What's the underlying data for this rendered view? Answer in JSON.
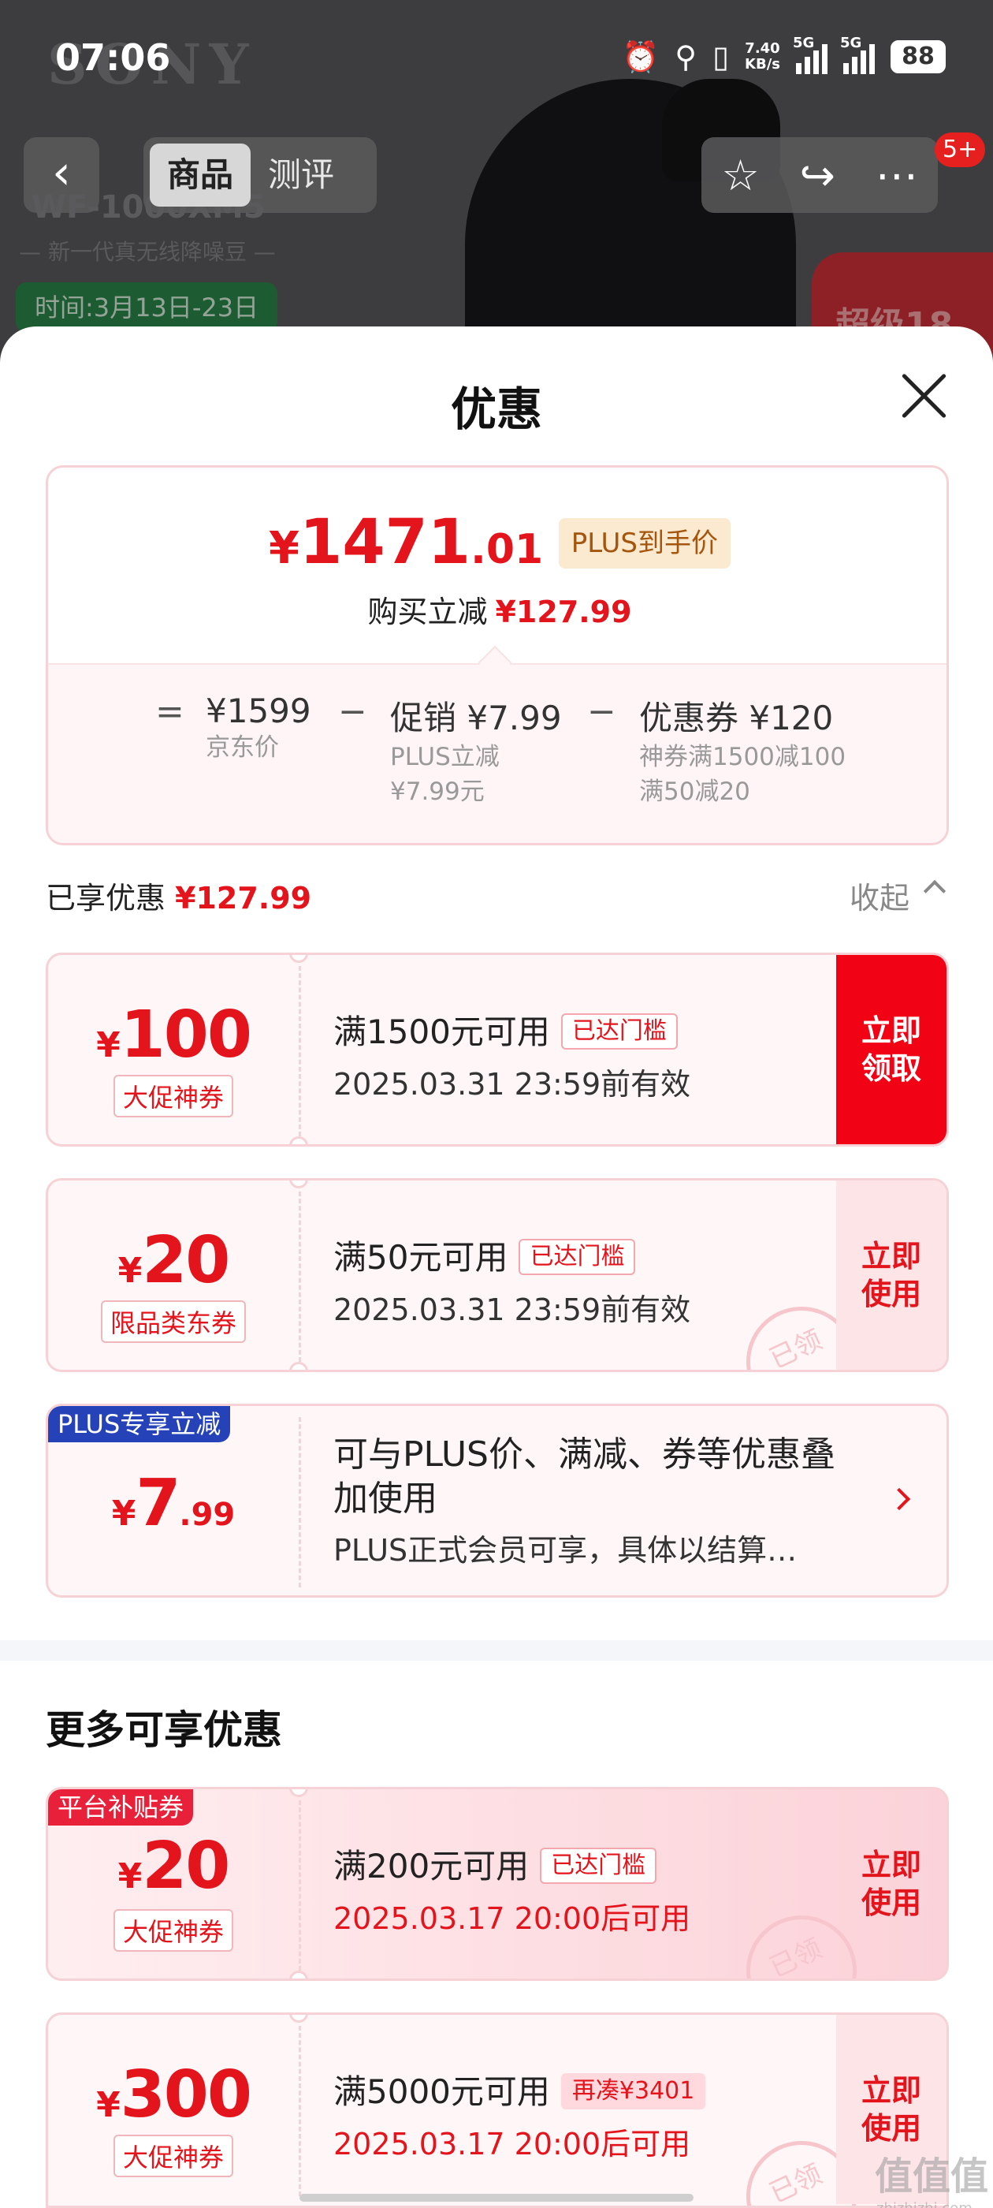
{
  "status_bar": {
    "time": "07:06",
    "speed": "7.40",
    "speed_unit": "KB/s",
    "net1": "5G",
    "net2": "5G",
    "battery": "88"
  },
  "background": {
    "brand": "SONY",
    "model": "WF-1000XM5",
    "tagline": "— 新一代真无线降噪豆 —",
    "time_range": "时间:3月13日-23日",
    "promo": "超级18"
  },
  "nav": {
    "tabs": [
      "商品",
      "测评"
    ],
    "badge": "5+"
  },
  "sheet": {
    "title": "优惠",
    "price": {
      "currency": "¥",
      "integer": "1471",
      "decimal": ".01",
      "tag": "PLUS到手价",
      "save_label": "购买立减",
      "save_amount": "¥127.99",
      "breakdown": {
        "eq": "=",
        "minus": "−",
        "jd_price": "¥1599",
        "jd_label": "京东价",
        "promo_val": "促销 ¥7.99",
        "promo_sub1": "PLUS立减",
        "promo_sub2": "¥7.99元",
        "coupon_val": "优惠券 ¥120",
        "coupon_sub1": "神券满1500减100",
        "coupon_sub2": "满50减20"
      }
    },
    "enjoyed_label": "已享优惠",
    "enjoyed_amount": "¥127.99",
    "collapse_label": "收起",
    "coupons": [
      {
        "cur": "¥",
        "amount": "100",
        "type": "大促神券",
        "cond": "满1500元可用",
        "tag": "已达门槛",
        "date": "2025.03.31 23:59前有效",
        "btn1": "立即",
        "btn2": "领取"
      },
      {
        "cur": "¥",
        "amount": "20",
        "type": "限品类东券",
        "cond": "满50元可用",
        "tag": "已达门槛",
        "date": "2025.03.31 23:59前有效",
        "btn1": "立即",
        "btn2": "使用",
        "stamp": "已领"
      }
    ],
    "plus": {
      "corner": "PLUS专享立减",
      "cur": "¥",
      "int": "7",
      "dec": ".99",
      "title": "可与PLUS价、满减、券等优惠叠加使用",
      "note": "PLUS正式会员可享，具体以结算…"
    },
    "more_title": "更多可享优惠",
    "more": [
      {
        "corner": "平台补贴券",
        "cur": "¥",
        "amount": "20",
        "type": "大促神券",
        "cond": "满200元可用",
        "tag": "已达门槛",
        "date": "2025.03.17 20:00后可用",
        "btn1": "立即",
        "btn2": "使用",
        "stamp": "已领"
      },
      {
        "cur": "¥",
        "amount": "300",
        "type": "大促神券",
        "cond": "满5000元可用",
        "tag": "再凑¥3401",
        "date": "2025.03.17 20:00后可用",
        "btn1": "立即",
        "btn2": "使用",
        "stamp": "已领"
      }
    ]
  },
  "watermark": {
    "main": "值值值",
    "sub": "zhizhizhi.com"
  }
}
